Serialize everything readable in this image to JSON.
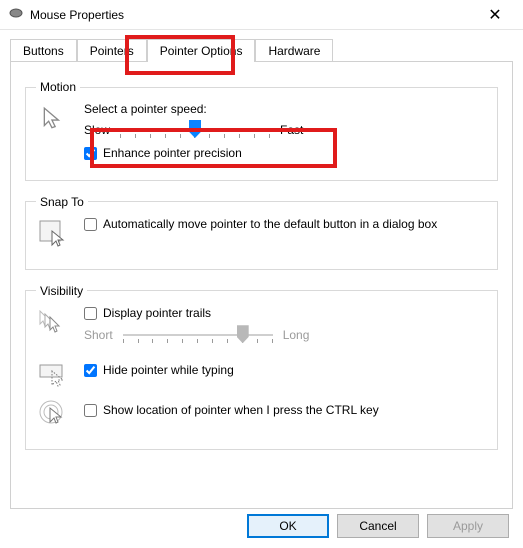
{
  "window": {
    "title": "Mouse Properties"
  },
  "tabs": {
    "items": [
      "Buttons",
      "Pointers",
      "Pointer Options",
      "Hardware"
    ],
    "active_index": 2
  },
  "groups": {
    "motion": {
      "legend": "Motion",
      "label": "Select a pointer speed:",
      "slow": "Slow",
      "fast": "Fast",
      "slider": {
        "min": 0,
        "max": 10,
        "value": 5
      },
      "enhance": {
        "label": "Enhance pointer precision",
        "checked": true
      }
    },
    "snap": {
      "legend": "Snap To",
      "auto": {
        "label": "Automatically move pointer to the default button in a dialog box",
        "checked": false
      }
    },
    "visibility": {
      "legend": "Visibility",
      "trails": {
        "label": "Display pointer trails",
        "checked": false,
        "short": "Short",
        "long": "Long",
        "slider": {
          "min": 0,
          "max": 10,
          "value": 8,
          "enabled": false
        }
      },
      "hide": {
        "label": "Hide pointer while typing",
        "checked": true
      },
      "ctrl": {
        "label": "Show location of pointer when I press the CTRL key",
        "checked": false
      }
    }
  },
  "buttons": {
    "ok": "OK",
    "cancel": "Cancel",
    "apply": "Apply"
  }
}
